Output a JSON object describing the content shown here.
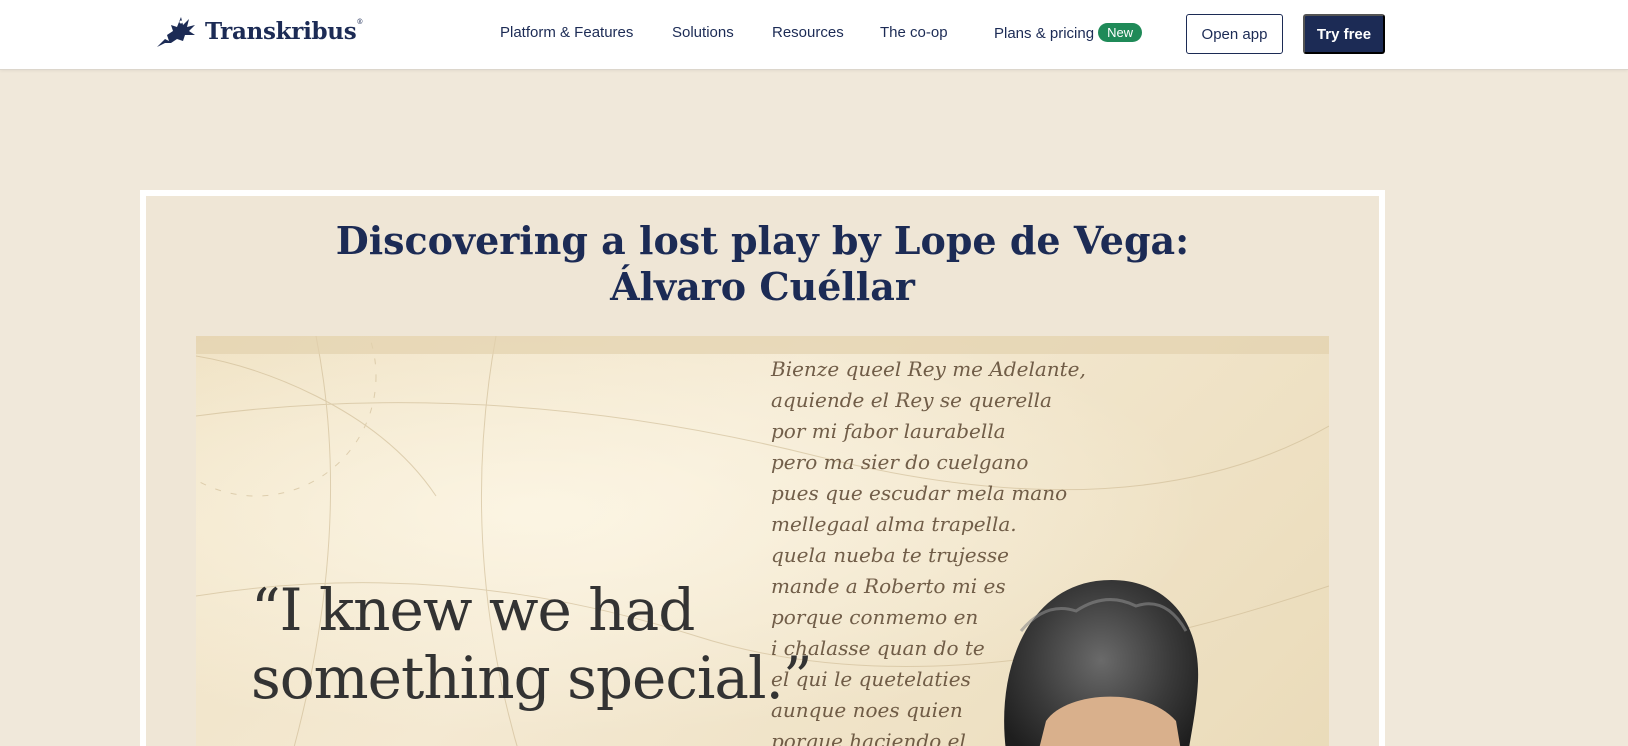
{
  "brand": {
    "name": "Transkribus",
    "registered": "®"
  },
  "nav": {
    "items": [
      {
        "label": "Platform & Features"
      },
      {
        "label": "Solutions"
      },
      {
        "label": "Resources"
      },
      {
        "label": "The co-op"
      },
      {
        "label": "Plans & pricing",
        "badge": "New"
      }
    ],
    "open_app": "Open app",
    "try_free": "Try free"
  },
  "story": {
    "title_line1": "Discovering a lost play by Lope de Vega:",
    "title_line2": "Álvaro Cuéllar",
    "quote_line1": "“I knew we had",
    "quote_line2": "something special.”",
    "manuscript_lines": [
      "Bienze queel Rey me Adelante,",
      "aquiende el Rey se querella",
      "por mi fabor laurabella",
      "pero ma sier do cuelgano",
      "pues que escudar mela mano",
      "mellegaal alma trapella.",
      "quela nueba te trujesse",
      "mande a Roberto mi es",
      "porque conmemo en",
      "i chalasse quan do te",
      "el qui le quetelaties",
      "aunque noes quien",
      "porque haciendo el"
    ]
  },
  "colors": {
    "navy": "#1c2b55",
    "badge_green": "#1f8a58",
    "page_bg": "#f0e8da"
  },
  "icons": {
    "logo": "winged-lion-icon"
  }
}
